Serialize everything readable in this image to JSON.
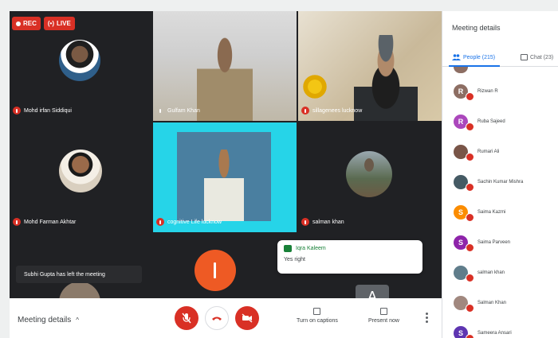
{
  "badges": {
    "rec": "REC",
    "live": "LIVE"
  },
  "tiles": [
    {
      "name": "Mohd irfan Siddiqui"
    },
    {
      "name": "Gulfam Khan"
    },
    {
      "name": "sillagenees lucknow"
    },
    {
      "name": "Mohd Farman Akhtar"
    },
    {
      "name": "cognitive Life lucknow"
    },
    {
      "name": "salman khan"
    }
  ],
  "toast_left": "Subhi Gupta has left the meeting",
  "chat_popup": {
    "author": "Iqra Kaleem",
    "message": "Yes right"
  },
  "letter_tile": "A",
  "bottombar": {
    "meeting_details": "Meeting details",
    "captions": "Turn on captions",
    "present": "Present now"
  },
  "sidebar": {
    "title": "Meeting details",
    "tab_people": "People (215)",
    "tab_chat": "Chat (23)",
    "people": [
      {
        "name": "Rizwan R",
        "initial": "R",
        "color": "#8d6e63"
      },
      {
        "name": "Ruba Sajeed",
        "initial": "R",
        "color": "#ab47bc"
      },
      {
        "name": "Rumari Ali",
        "initial": "",
        "color": "#795548"
      },
      {
        "name": "Sachin Kumar Mishra",
        "initial": "",
        "color": "#455a64"
      },
      {
        "name": "Saima Kazmi",
        "initial": "S",
        "color": "#fb8c00"
      },
      {
        "name": "Saima Parveen",
        "initial": "S",
        "color": "#8e24aa"
      },
      {
        "name": "salman khan",
        "initial": "",
        "color": "#607d8b"
      },
      {
        "name": "Salman Khan",
        "initial": "",
        "color": "#a1887f"
      },
      {
        "name": "Sameera Ansari",
        "initial": "S",
        "color": "#5e35b1"
      }
    ]
  }
}
